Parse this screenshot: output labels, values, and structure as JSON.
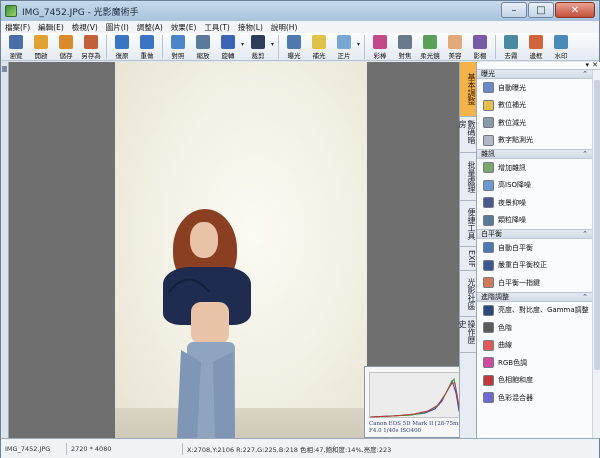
{
  "window": {
    "title": "IMG_7452.JPG - 光影魔術手"
  },
  "menu": [
    "檔案(F)",
    "編輯(E)",
    "檢視(V)",
    "圖片(I)",
    "調整(A)",
    "效果(E)",
    "工具(T)",
    "接物(L)",
    "說明(H)"
  ],
  "toolbar": [
    {
      "label": "瀏覽",
      "icon": "browse-icon",
      "color": "#4a6fa8"
    },
    {
      "label": "開啟",
      "icon": "folder-open-icon",
      "color": "#e0a232"
    },
    {
      "label": "儲存",
      "icon": "save-icon",
      "color": "#d98a2a"
    },
    {
      "label": "另存為",
      "icon": "save-as-icon",
      "color": "#c2603a"
    },
    {
      "label": "復原",
      "icon": "undo-icon",
      "color": "#3a74c4"
    },
    {
      "label": "重做",
      "icon": "redo-icon",
      "color": "#3a74c4"
    },
    {
      "label": "對照",
      "icon": "compare-icon",
      "color": "#4c86c9"
    },
    {
      "label": "縮放",
      "icon": "zoom-icon",
      "color": "#5a7a9a"
    },
    {
      "label": "旋轉",
      "icon": "rotate-icon",
      "color": "#3a64b4"
    },
    {
      "label": "裁剪",
      "icon": "crop-icon",
      "color": "#2e3e5a"
    },
    {
      "label": "曝光",
      "icon": "exposure-icon",
      "color": "#4d78b0"
    },
    {
      "label": "補光",
      "icon": "fill-light-icon",
      "color": "#e0c24a"
    },
    {
      "label": "正片",
      "icon": "positive-film-icon",
      "color": "#7aa6d6"
    },
    {
      "label": "彩棒",
      "icon": "color-wand-icon",
      "color": "#c04a8a"
    },
    {
      "label": "對焦",
      "icon": "focus-icon",
      "color": "#6a7a8a"
    },
    {
      "label": "柔光鏡",
      "icon": "soft-lens-icon",
      "color": "#5aa05a"
    },
    {
      "label": "美容",
      "icon": "beauty-icon",
      "color": "#e2aa7a"
    },
    {
      "label": "影棚",
      "icon": "studio-icon",
      "color": "#7a5aa8"
    },
    {
      "label": "去霧",
      "icon": "dehaze-icon",
      "color": "#4a8aa0"
    },
    {
      "label": "邊框",
      "icon": "frame-icon",
      "color": "#d0643a"
    },
    {
      "label": "水印",
      "icon": "watermark-icon",
      "color": "#4a8ab8"
    }
  ],
  "vtabs": [
    "基本調整",
    "數碼暗房",
    "批量處理",
    "便捷工具",
    "EXIF",
    "光影社區",
    "操作歷史"
  ],
  "panel": {
    "sections": [
      {
        "title": "曝光",
        "items": [
          {
            "label": "自動曝光",
            "icon": "auto-exposure-icon",
            "color": "#6a8ac6"
          },
          {
            "label": "數位補光",
            "icon": "digital-fill-icon",
            "color": "#e6c04a"
          },
          {
            "label": "數位減光",
            "icon": "digital-reduce-icon",
            "color": "#8a9aaa"
          },
          {
            "label": "數字點測光",
            "icon": "spot-metering-icon",
            "color": "#b0b8c4"
          }
        ]
      },
      {
        "title": "雜訊",
        "items": [
          {
            "label": "增加雜訊",
            "icon": "add-noise-icon",
            "color": "#7aa86a"
          },
          {
            "label": "高ISO降噪",
            "icon": "iso-denoise-icon",
            "color": "#6a9ad0"
          },
          {
            "label": "夜景抑噪",
            "icon": "night-denoise-icon",
            "color": "#4a5a8a"
          },
          {
            "label": "顆粒降噪",
            "icon": "grain-denoise-icon",
            "color": "#5a7a9a"
          }
        ]
      },
      {
        "title": "白平衡",
        "items": [
          {
            "label": "自動白平衡",
            "icon": "auto-wb-icon",
            "color": "#4a7ab0"
          },
          {
            "label": "嚴重白平衡校正",
            "icon": "wb-correction-icon",
            "color": "#3a5a90"
          },
          {
            "label": "白平衡一指鍵",
            "icon": "wb-onekey-icon",
            "color": "#d07a5a"
          }
        ]
      },
      {
        "title": "進階調整",
        "items": [
          {
            "label": "亮度、對比度、Gamma調整",
            "icon": "brightness-contrast-icon",
            "color": "#2a4a7a"
          },
          {
            "label": "色階",
            "icon": "levels-icon",
            "color": "#5a5a5a"
          },
          {
            "label": "曲線",
            "icon": "curves-icon",
            "color": "#e05a5a"
          },
          {
            "label": "RGB色調",
            "icon": "rgb-tone-icon",
            "color": "#d04aa0"
          },
          {
            "label": "色相飽和度",
            "icon": "hue-saturation-icon",
            "color": "#c03a3a"
          },
          {
            "label": "色彩混合器",
            "icon": "color-mixer-icon",
            "color": "#6a6ad0"
          }
        ]
      }
    ]
  },
  "histogram": {
    "caption_line1": "Canon EOS 5D Mark II [28-75mm]",
    "caption_line2": "F4.0 1/40s ISO400"
  },
  "status": {
    "file": "IMG_7452.JPG",
    "size": "2720 * 4080",
    "info": "X:2708,Y:2106 R:227,G:225,B:218 色相:47,飽和度:14%,亮度:223"
  }
}
